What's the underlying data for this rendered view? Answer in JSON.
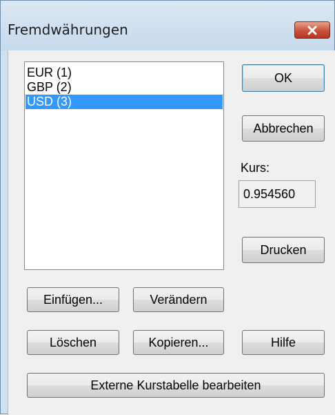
{
  "window": {
    "title": "Fremdwährungen"
  },
  "currency_list": {
    "items": [
      {
        "label": "EUR (1)",
        "selected": false
      },
      {
        "label": "GBP (2)",
        "selected": false
      },
      {
        "label": "USD (3)",
        "selected": true
      }
    ]
  },
  "buttons": {
    "ok": "OK",
    "cancel": "Abbrechen",
    "print": "Drucken",
    "insert": "Einfügen...",
    "change": "Verändern",
    "delete": "Löschen",
    "copy": "Kopieren...",
    "help": "Hilfe",
    "external_table": "Externe Kurstabelle bearbeiten"
  },
  "rate": {
    "label": "Kurs:",
    "value": "0.954560"
  },
  "colors": {
    "selection": "#3399ff",
    "close_button": "#c8513a"
  }
}
